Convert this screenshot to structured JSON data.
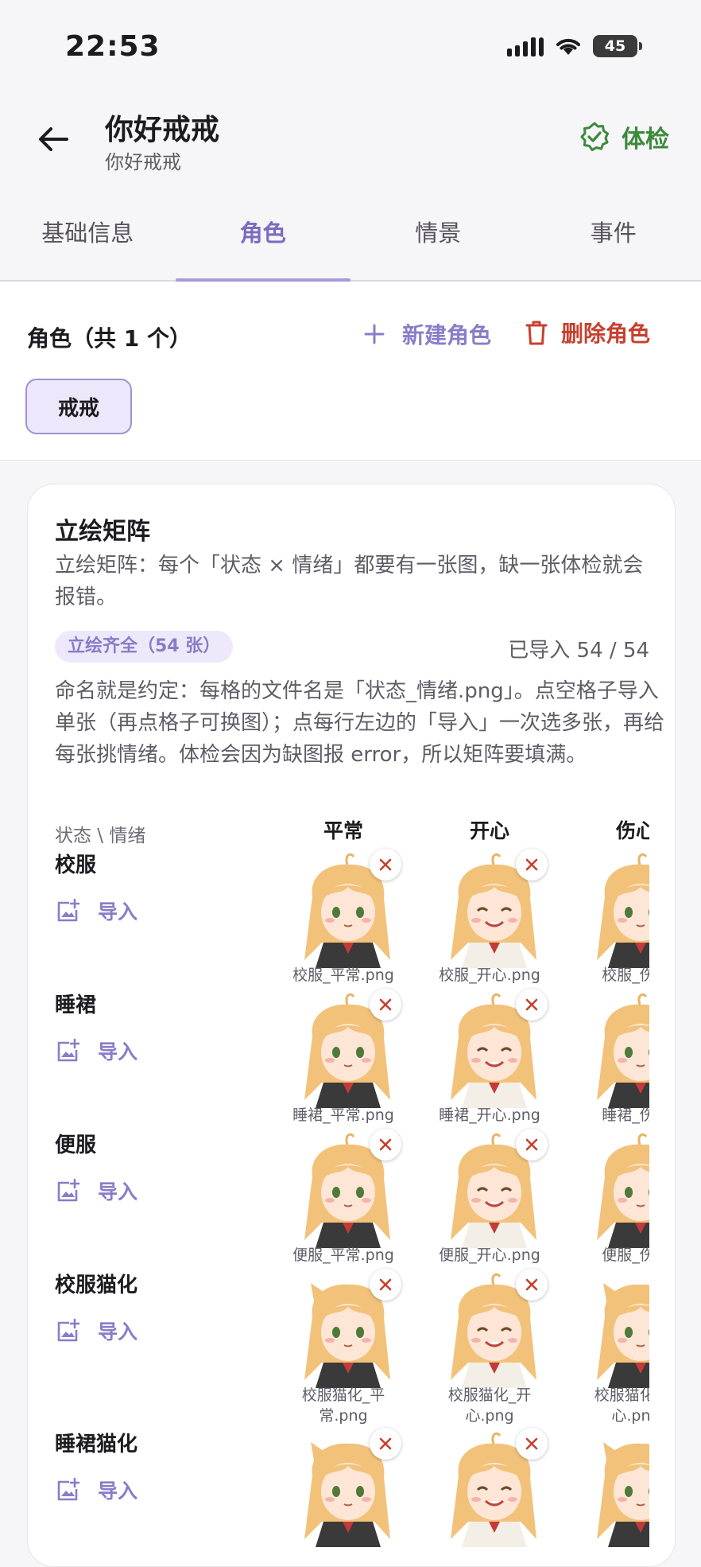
{
  "status": {
    "time": "22:53",
    "battery": "45"
  },
  "header": {
    "title": "你好戒戒",
    "subtitle": "你好戒戒",
    "checkup_label": "体检"
  },
  "tabs": [
    {
      "label": "基础信息"
    },
    {
      "label": "角色"
    },
    {
      "label": "情景"
    },
    {
      "label": "事件"
    }
  ],
  "roles": {
    "count_label": "角色（共 1 个）",
    "new_label": "新建角色",
    "delete_label": "删除角色",
    "chips": [
      "戒戒"
    ]
  },
  "card": {
    "title": "立绘矩阵",
    "description": "立绘矩阵：每个「状态 × 情绪」都要有一张图，缺一张体检就会报错。",
    "pill": "立绘齐全（54 张）",
    "imported": "已导入 54 / 54",
    "naming": "命名就是约定：每格的文件名是「状态_情绪.png」。点空格子导入单张（再点格子可换图）；点每行左边的「导入」一次选多张，再给每张挑情绪。体检会因为缺图报 error，所以矩阵要填满。",
    "corner_label": "状态 \\ 情绪",
    "import_label": "导入",
    "columns": [
      "平常",
      "开心",
      "伤心"
    ],
    "rows": [
      {
        "name": "校服",
        "files": [
          "校服_平常.png",
          "校服_开心.png",
          "校服_伤心"
        ]
      },
      {
        "name": "睡裙",
        "files": [
          "睡裙_平常.png",
          "睡裙_开心.png",
          "睡裙_伤心"
        ]
      },
      {
        "name": "便服",
        "files": [
          "便服_平常.png",
          "便服_开心.png",
          "便服_伤心"
        ]
      },
      {
        "name": "校服猫化",
        "files": [
          "校服猫化_平常.png",
          "校服猫化_开心.png",
          "校服猫化_伤心.png"
        ]
      },
      {
        "name": "睡裙猫化",
        "files": [
          "",
          "",
          ""
        ]
      }
    ]
  },
  "colors": {
    "accent": "#8b7cc9",
    "danger": "#c7402f",
    "ok": "#3b8a3a"
  }
}
